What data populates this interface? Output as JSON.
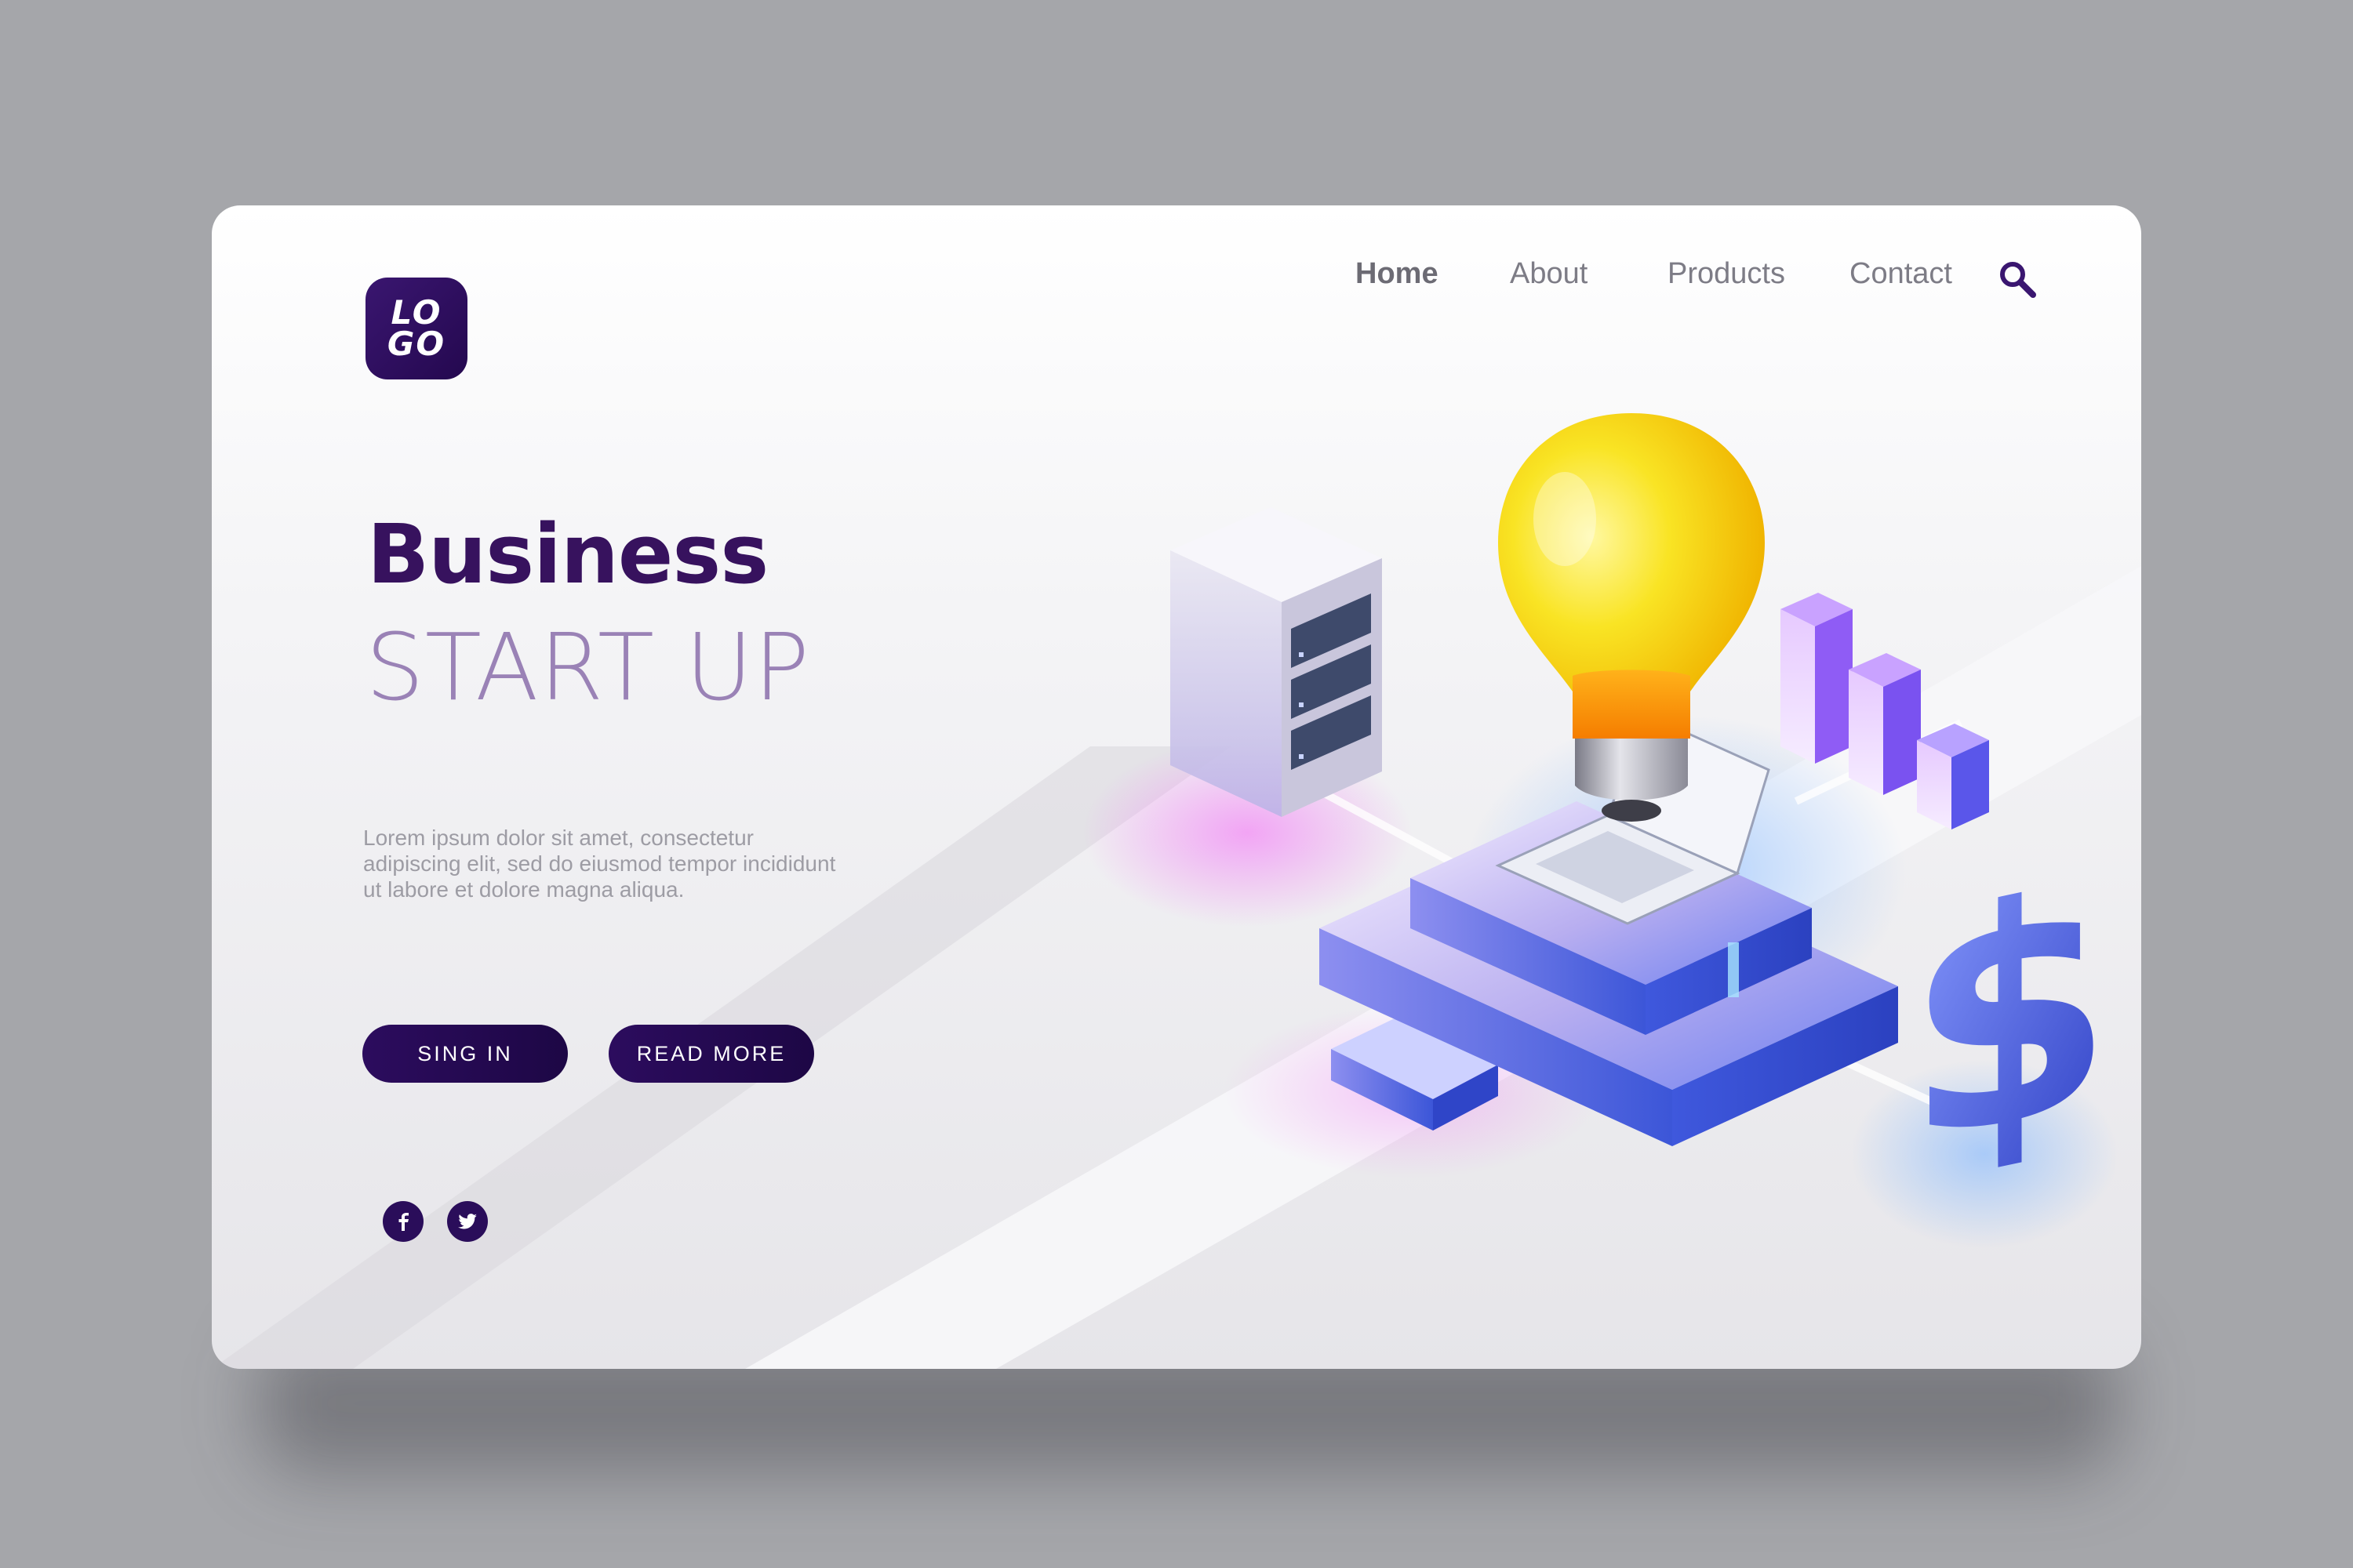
{
  "header": {
    "logo_text": "LO\nGO",
    "nav": [
      {
        "label": "Home",
        "active": true
      },
      {
        "label": "About",
        "active": false
      },
      {
        "label": "Products",
        "active": false
      },
      {
        "label": "Contact",
        "active": false
      }
    ],
    "search_icon": "search-icon"
  },
  "hero": {
    "title": "Business",
    "subtitle": "START UP",
    "body": "Lorem ipsum dolor sit amet, consectetur adipiscing elit, sed do eiusmod tempor incididunt ut labore et dolore magna aliqua.",
    "buttons": {
      "sign_in": "SING IN",
      "read_more": "READ MORE"
    }
  },
  "social": {
    "facebook_icon": "facebook-icon",
    "twitter_icon": "twitter-icon"
  },
  "colors": {
    "background": "#a5a6aa",
    "brand_dark": "#2a0d5a",
    "title": "#37125e",
    "subtitle": "#9a82b6",
    "accent_blue": "#4a63e0",
    "bulb_yellow": "#f7e21c"
  }
}
